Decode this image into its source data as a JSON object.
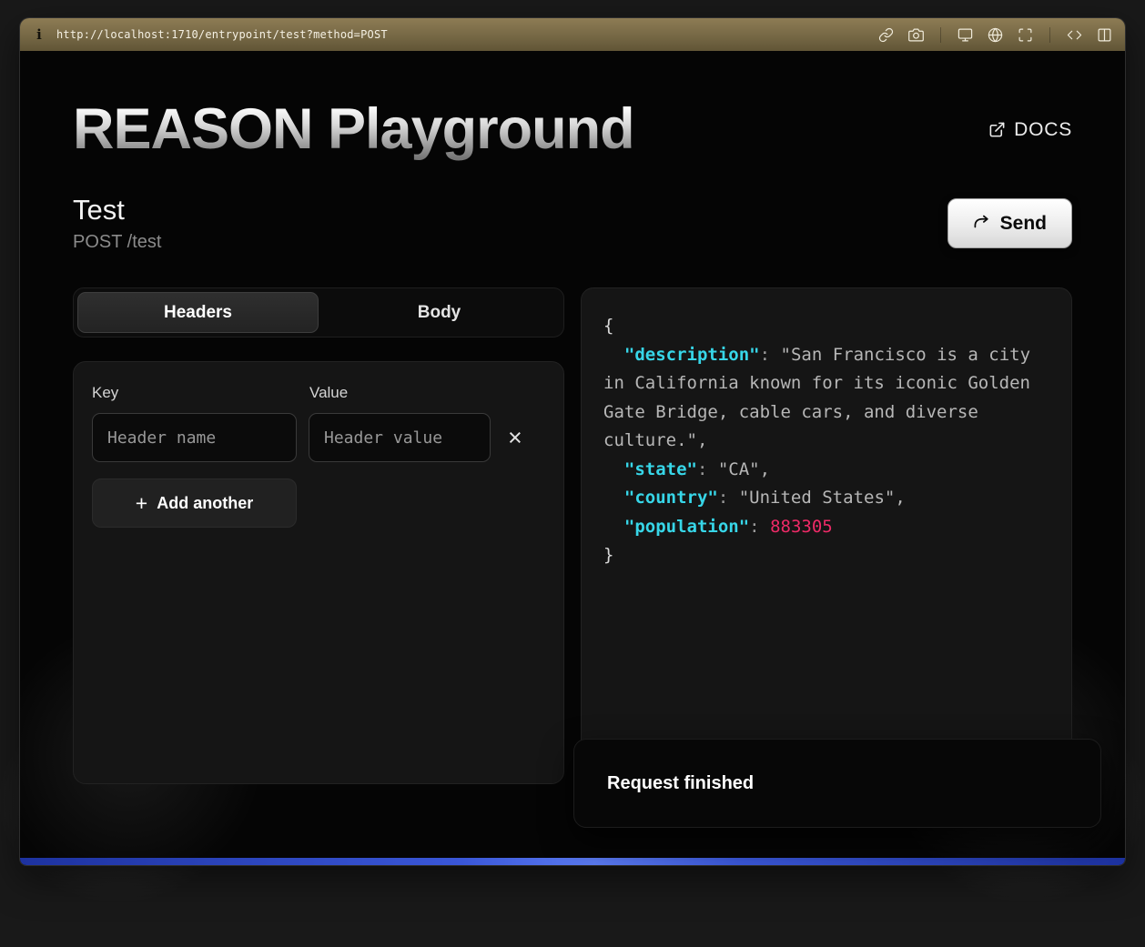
{
  "browser": {
    "url": "http://localhost:1710/entrypoint/test?method=POST",
    "info_icon": "i",
    "icons": [
      "link-icon",
      "camera-icon",
      "display-icon",
      "globe-icon",
      "scan-icon",
      "code-icon",
      "layout-columns-icon"
    ]
  },
  "header": {
    "title": "REASON Playground",
    "docs_label": "DOCS",
    "docs_icon": "external-link-icon"
  },
  "endpoint": {
    "name": "Test",
    "method_path": "POST /test",
    "send_label": "Send",
    "send_icon": "arrow-redo-icon"
  },
  "tabs": {
    "headers_label": "Headers",
    "body_label": "Body",
    "active": "Headers"
  },
  "headers_panel": {
    "key_label": "Key",
    "value_label": "Value",
    "key_placeholder": "Header name",
    "value_placeholder": "Header value",
    "key_value": "",
    "value_value": "",
    "remove_label": "×",
    "add_plus": "+",
    "add_label": "Add another"
  },
  "response": {
    "open_brace": "{",
    "close_brace": "}",
    "fields": [
      {
        "key": "  \"description\"",
        "sep": ": ",
        "value": "\"San Francisco is a city in California known for its iconic Golden Gate Bridge, cable cars, and diverse culture.\",",
        "type": "string"
      },
      {
        "key": "  \"state\"",
        "sep": ": ",
        "value": "\"CA\",",
        "type": "string"
      },
      {
        "key": "  \"country\"",
        "sep": ": ",
        "value": "\"United States\",",
        "type": "string"
      },
      {
        "key": "  \"population\"",
        "sep": ": ",
        "value": "883305",
        "type": "number"
      }
    ],
    "colors": {
      "key": "#37d6e8",
      "string": "#b7b7b7",
      "number": "#ee2a67",
      "punct": "#9a9a9a"
    }
  },
  "toast": {
    "message": "Request finished"
  },
  "colors": {
    "topbar": "#766845",
    "bottom_edge_blue": "#3a57d8",
    "send_button": "#ececec",
    "background": "#050505"
  }
}
